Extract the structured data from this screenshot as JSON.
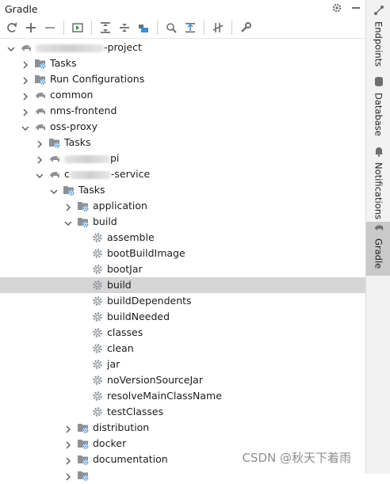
{
  "window": {
    "title": "Gradle"
  },
  "right_tabs": [
    {
      "label": "Endpoints",
      "icon": "endpoints-icon"
    },
    {
      "label": "Database",
      "icon": "database-icon"
    },
    {
      "label": "Notifications",
      "icon": "bell-icon"
    },
    {
      "label": "Gradle",
      "icon": "elephant-icon"
    }
  ],
  "toolbar": [
    "refresh-icon",
    "add-icon",
    "remove-icon",
    "run-task-icon",
    "expand-all-icon",
    "collapse-all-icon",
    "link-project-icon",
    "analyze-dependencies-icon",
    "toggle-offline-icon",
    "toggle-skip-tests-icon",
    "gradle-settings-icon"
  ],
  "tree": [
    {
      "depth": 0,
      "arrow": "down",
      "icon": "elephant",
      "label": "-project",
      "blur": 86,
      "name": "root-project"
    },
    {
      "depth": 1,
      "arrow": "right",
      "icon": "folder-gear",
      "label": "Tasks",
      "name": "tasks"
    },
    {
      "depth": 1,
      "arrow": "right",
      "icon": "folder-gear",
      "label": "Run Configurations",
      "name": "run-configurations"
    },
    {
      "depth": 1,
      "arrow": "right",
      "icon": "elephant",
      "label": "common",
      "name": "module-common"
    },
    {
      "depth": 1,
      "arrow": "right",
      "icon": "elephant",
      "label": "nms-frontend",
      "name": "module-nms-frontend"
    },
    {
      "depth": 1,
      "arrow": "down",
      "icon": "elephant",
      "label": "oss-proxy",
      "name": "module-oss-proxy"
    },
    {
      "depth": 2,
      "arrow": "right",
      "icon": "folder-gear",
      "label": "Tasks",
      "name": "oss-proxy-tasks"
    },
    {
      "depth": 2,
      "arrow": "right",
      "icon": "elephant",
      "label": "pi",
      "blur": 58,
      "name": "module-api"
    },
    {
      "depth": 2,
      "arrow": "down",
      "icon": "elephant",
      "label": "-service",
      "prefix": "c",
      "blur": 52,
      "name": "module-service"
    },
    {
      "depth": 3,
      "arrow": "down",
      "icon": "folder-gear",
      "label": "Tasks",
      "name": "service-tasks"
    },
    {
      "depth": 4,
      "arrow": "right",
      "icon": "folder-gear",
      "label": "application",
      "name": "task-group-application"
    },
    {
      "depth": 4,
      "arrow": "down",
      "icon": "folder-gear",
      "label": "build",
      "name": "task-group-build"
    },
    {
      "depth": 5,
      "icon": "gear",
      "label": "assemble",
      "name": "task-assemble"
    },
    {
      "depth": 5,
      "icon": "gear",
      "label": "bootBuildImage",
      "name": "task-bootbuildimage"
    },
    {
      "depth": 5,
      "icon": "gear",
      "label": "bootJar",
      "name": "task-bootjar"
    },
    {
      "depth": 5,
      "icon": "gear",
      "label": "build",
      "name": "task-build",
      "selected": true
    },
    {
      "depth": 5,
      "icon": "gear",
      "label": "buildDependents",
      "name": "task-builddependents"
    },
    {
      "depth": 5,
      "icon": "gear",
      "label": "buildNeeded",
      "name": "task-buildneeded"
    },
    {
      "depth": 5,
      "icon": "gear",
      "label": "classes",
      "name": "task-classes"
    },
    {
      "depth": 5,
      "icon": "gear",
      "label": "clean",
      "name": "task-clean"
    },
    {
      "depth": 5,
      "icon": "gear",
      "label": "jar",
      "name": "task-jar"
    },
    {
      "depth": 5,
      "icon": "gear",
      "label": "noVersionSourceJar",
      "name": "task-noversionsourcejar"
    },
    {
      "depth": 5,
      "icon": "gear",
      "label": "resolveMainClassName",
      "name": "task-resolvemainclassname"
    },
    {
      "depth": 5,
      "icon": "gear",
      "label": "testClasses",
      "name": "task-testclasses"
    },
    {
      "depth": 4,
      "arrow": "right",
      "icon": "folder-gear",
      "label": "distribution",
      "name": "task-group-distribution"
    },
    {
      "depth": 4,
      "arrow": "right",
      "icon": "folder-gear",
      "label": "docker",
      "name": "task-group-docker"
    },
    {
      "depth": 4,
      "arrow": "right",
      "icon": "folder-gear",
      "label": "documentation",
      "name": "task-group-documentation"
    },
    {
      "depth": 4,
      "arrow": "right",
      "icon": "folder-gear",
      "label": "",
      "name": "task-group-partial"
    }
  ],
  "watermark": "CSDN @秋天下着雨",
  "colors": {
    "selection": "#d5d5d5",
    "icon": "#6e6e6e",
    "folder": "#8d9196",
    "gear_badge": "#3d8dd8"
  }
}
